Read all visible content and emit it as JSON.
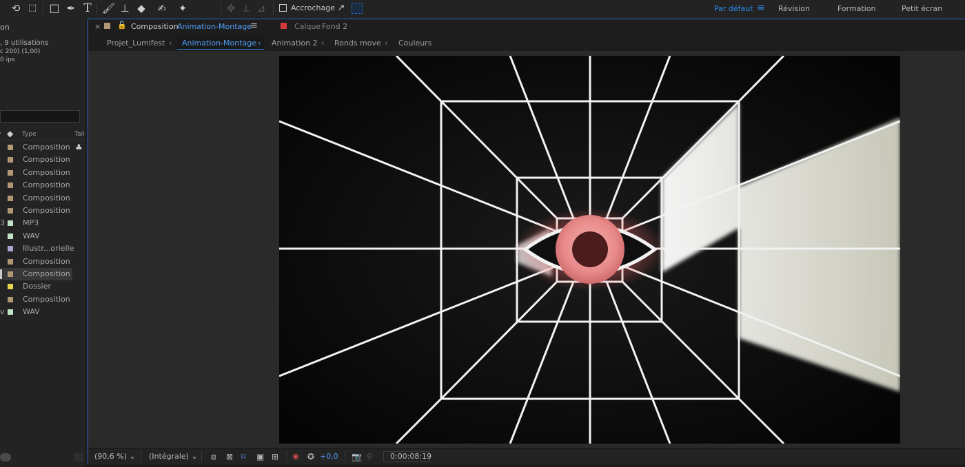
{
  "toolbar": {
    "snapping_label": "Accrochage",
    "workspaces": [
      "Par défaut",
      "Révision",
      "Formation",
      "Petit écran"
    ]
  },
  "project_panel": {
    "title_fragment": "on",
    "info_line1": ", 9 utilisations",
    "info_line2": "c 200) (1,00)",
    "info_line3": "0 ips",
    "col_type": "Type",
    "col_size": "Tail",
    "items": [
      {
        "label": "",
        "type": "Composition",
        "color": "#b29775",
        "selected": false
      },
      {
        "label": "",
        "type": "Composition",
        "color": "#b29775",
        "selected": false
      },
      {
        "label": "",
        "type": "Composition",
        "color": "#b29775",
        "selected": false
      },
      {
        "label": "",
        "type": "Composition",
        "color": "#b29775",
        "selected": false
      },
      {
        "label": "",
        "type": "Composition",
        "color": "#b29775",
        "selected": false
      },
      {
        "label": "",
        "type": "Composition",
        "color": "#b29775",
        "selected": false
      },
      {
        "label": "3",
        "type": "MP3",
        "color": "#bfe3c6",
        "selected": false
      },
      {
        "label": "",
        "type": "WAV",
        "color": "#bfe3c6",
        "selected": false
      },
      {
        "label": "",
        "type": "Illustr...orielle",
        "color": "#a9a6cf",
        "selected": false
      },
      {
        "label": "",
        "type": "Composition",
        "color": "#b29775",
        "selected": false
      },
      {
        "label": "",
        "type": "Composition",
        "color": "#b29775",
        "selected": true
      },
      {
        "label": "",
        "type": "Dossier",
        "color": "#e6d44a",
        "selected": false
      },
      {
        "label": "",
        "type": "Composition",
        "color": "#b29775",
        "selected": false
      },
      {
        "label": "v",
        "type": "WAV",
        "color": "#bfe3c6",
        "selected": false
      }
    ]
  },
  "comp_panel": {
    "tab_prefix": "Composition",
    "tab_comp_name": "Animation-Montage",
    "layer_prefix": "Calque",
    "layer_name": "Fond 2",
    "breadcrumbs": [
      "Projet_Lumifest",
      "Animation-Montage",
      "Animation 2",
      "Ronds move",
      "Couleurs"
    ]
  },
  "bottom_bar": {
    "zoom": "(90,6 %)",
    "resolution": "(Intégrale)",
    "exposure": "+0,0",
    "timecode": "0:00:08:19"
  },
  "colors": {
    "accent": "#2f7ed8",
    "composition_label": "#b29775",
    "layer_label": "#d23a3a"
  }
}
